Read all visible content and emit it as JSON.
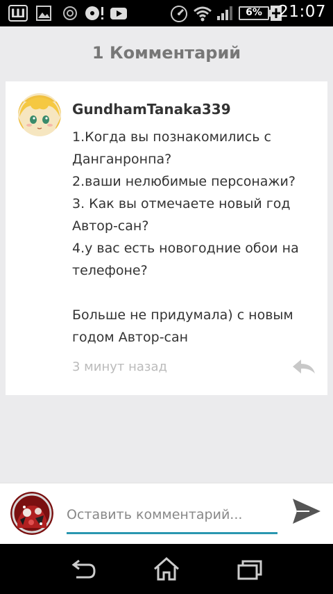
{
  "status_bar": {
    "time": "21:07",
    "battery_percent": "6%",
    "icons": [
      "tumblr-w-icon",
      "gallery-icon",
      "sync-icon",
      "media-alert-icon",
      "youtube-icon",
      "speedometer-icon",
      "wifi-icon",
      "signal-icon",
      "battery-icon",
      "charging-icon"
    ]
  },
  "header": {
    "title": "1 Комментарий"
  },
  "comment": {
    "author": "GundhamTanaka339",
    "text": "1.Когда вы познакомились с\nДанганронпа?\n2.ваши нелюбимые персонажи?\n3. Как вы отмечаете новый год\nАвтор-сан?\n4.у вас есть новогодние обои на\nтелефоне?\n\nБольше не придумала) с новым\nгодом Автор-сан",
    "time": "3 минут назад",
    "icons": [
      "avatar-icon",
      "reply-icon"
    ]
  },
  "composer": {
    "placeholder": "Оставить комментарий...",
    "value": "",
    "icons": [
      "avatar-icon",
      "send-icon"
    ],
    "accent": "#2a97b0"
  },
  "nav_bar": {
    "icons": [
      "back-icon",
      "home-icon",
      "recent-apps-icon"
    ]
  }
}
